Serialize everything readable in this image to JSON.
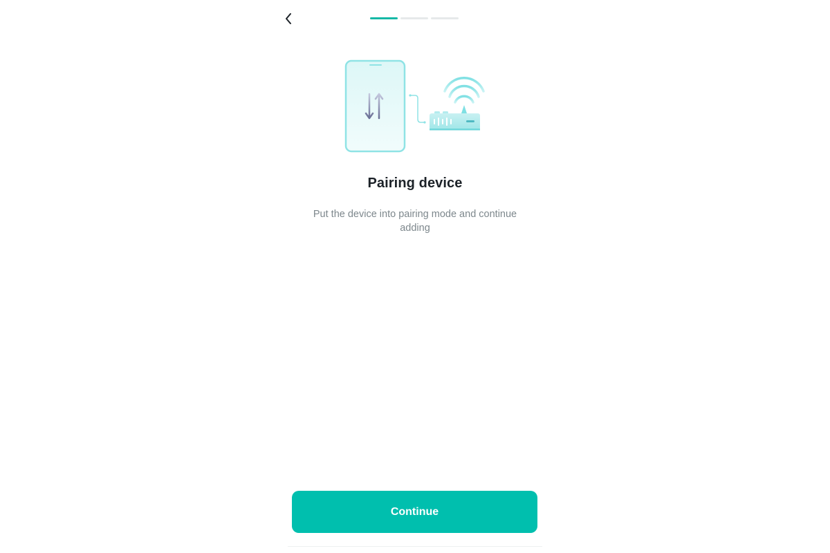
{
  "header": {
    "back_icon": "chevron-left-icon",
    "progress": {
      "steps": 3,
      "current": 1,
      "active_color": "#15b8a6",
      "inactive_color": "#e6e9ea"
    }
  },
  "illustration": {
    "phone_icon": "phone-transfer-icon",
    "router_icon": "wifi-router-icon",
    "accent_color": "#7fe0e3"
  },
  "content": {
    "title": "Pairing device",
    "subtitle": "Put the device into pairing mode and continue adding"
  },
  "footer": {
    "continue_label": "Continue",
    "button_color": "#00bfae"
  }
}
